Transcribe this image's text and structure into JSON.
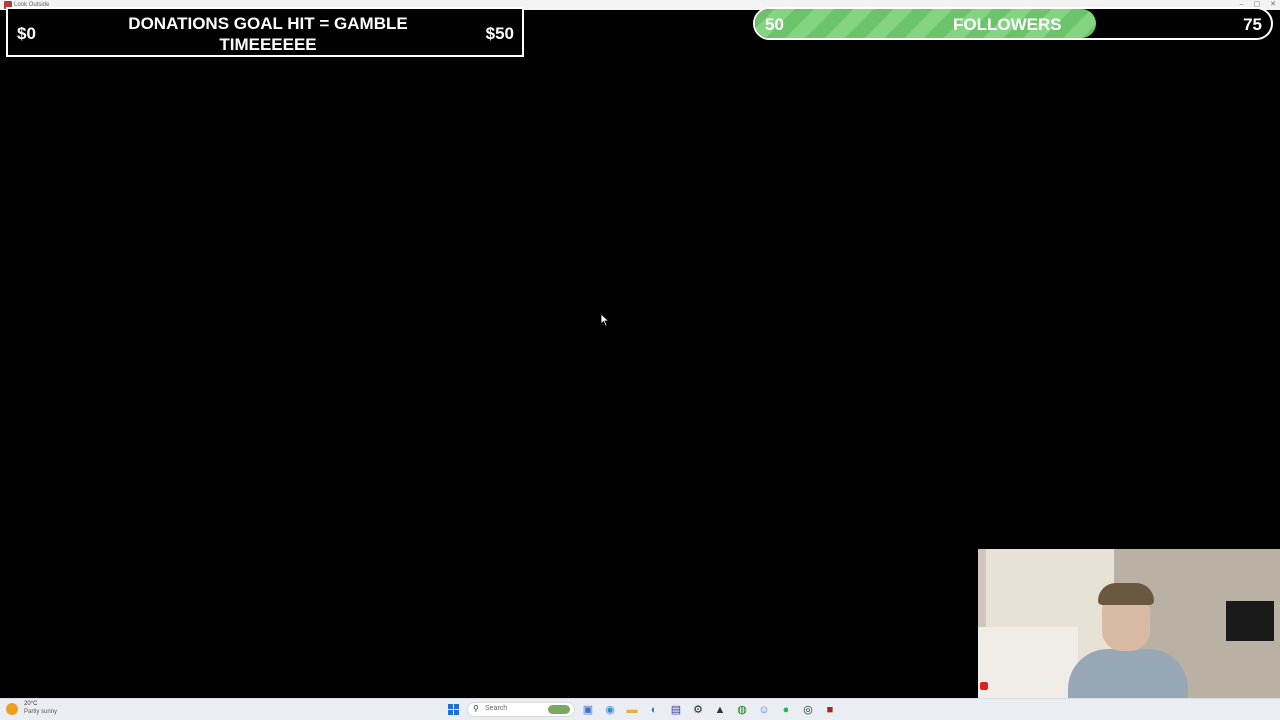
{
  "window": {
    "title": "Look Outside",
    "controls": [
      "–",
      "▢",
      "✕"
    ]
  },
  "donation_goal": {
    "current": "$0",
    "title": "DONATIONS GOAL HIT = GAMBLE TIMEEEEEE",
    "target": "$50"
  },
  "follower_goal": {
    "start": "50",
    "label": "FOLLOWERS",
    "end": "75",
    "progress_fraction": 0.66,
    "fill_color": "#6cc46a"
  },
  "taskbar": {
    "weather_temp": "20°C",
    "weather_desc": "Partly sunny",
    "search_placeholder": "Search",
    "apps": [
      {
        "icon": "widgets-icon",
        "glyph": "▣"
      },
      {
        "icon": "copilot-icon",
        "glyph": "◉"
      },
      {
        "icon": "file-explorer-icon",
        "glyph": "▬"
      },
      {
        "icon": "edge-icon",
        "glyph": "◐"
      },
      {
        "icon": "store-icon",
        "glyph": "▤"
      },
      {
        "icon": "steam-icon",
        "glyph": "⚙"
      },
      {
        "icon": "epic-games-icon",
        "glyph": "▲"
      },
      {
        "icon": "xbox-icon",
        "glyph": "◍"
      },
      {
        "icon": "discord-icon",
        "glyph": "☺"
      },
      {
        "icon": "spotify-icon",
        "glyph": "●"
      },
      {
        "icon": "steam-client-icon",
        "glyph": "◎"
      },
      {
        "icon": "game-app-icon",
        "glyph": "■"
      }
    ]
  }
}
